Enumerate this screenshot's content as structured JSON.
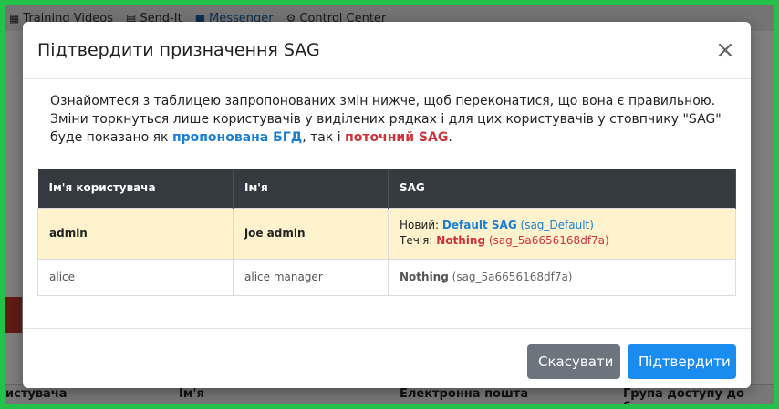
{
  "background": {
    "nav": [
      {
        "icon": "▦",
        "label": "Training Videos"
      },
      {
        "icon": "▤",
        "label": "Send-It"
      },
      {
        "icon": "■",
        "label": "Messenger"
      },
      {
        "icon": "⚙",
        "label": "Control Center"
      }
    ],
    "table_headers": [
      "истувача",
      "Ім'я",
      "Електронна пошта",
      "Група доступу до безпек"
    ]
  },
  "modal": {
    "title": "Підтвердити призначення SAG",
    "close": "×",
    "intro_part1": "Ознайомтеся з таблицею запропонованих змін нижче, щоб переконатися, що вона є правильною. Зміни торкнуться лише користувачів у виділених рядках і для цих користувачів у стовпчику \"SAG\" буде показано як ",
    "intro_proposed": "пропонована БГД",
    "intro_part2": ", так і ",
    "intro_current": "поточний SAG",
    "intro_part3": ".",
    "table": {
      "headers": [
        "Ім'я користувача",
        "Ім'я",
        "SAG"
      ],
      "rows": [
        {
          "username": "admin",
          "name": "joe admin",
          "new_label": "Новий: ",
          "new_sag": "Default SAG",
          "new_sag_id": "(sag_Default)",
          "current_label": "Течія: ",
          "current_sag": "Nothing",
          "current_sag_id": "(sag_5a6656168df7a)"
        },
        {
          "username": "alice",
          "name": "alice manager",
          "sag": "Nothing",
          "sag_id": "(sag_5a6656168df7a)"
        }
      ]
    },
    "buttons": {
      "cancel": "Скасувати",
      "confirm": "Підтвердити"
    }
  }
}
